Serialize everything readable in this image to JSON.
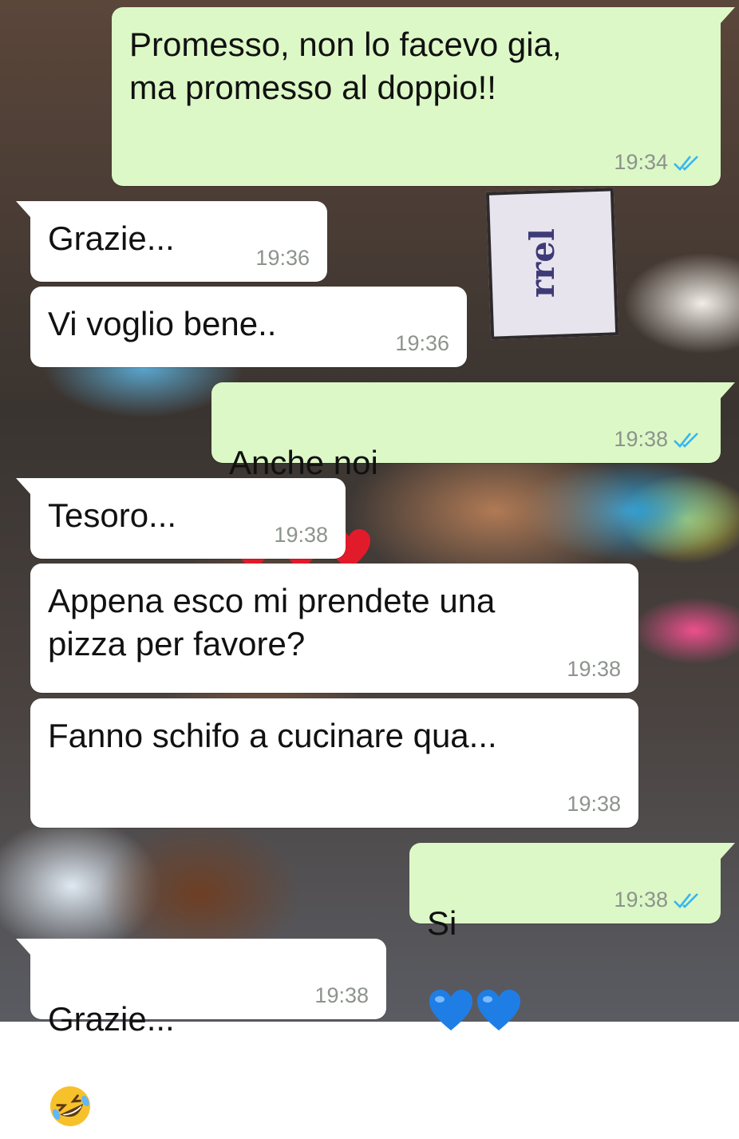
{
  "messages": [
    {
      "dir": "out",
      "text": "Promesso, non lo facevo gia,\nma promesso al doppio!!",
      "time": "19:34",
      "status": "read"
    },
    {
      "dir": "in",
      "text": "Grazie...",
      "time": "19:36"
    },
    {
      "dir": "in",
      "text": "Vi voglio bene..",
      "time": "19:36"
    },
    {
      "dir": "out",
      "text": "Anche noi",
      "emojis": [
        "red-heart",
        "red-heart",
        "red-heart"
      ],
      "time": "19:38",
      "status": "read"
    },
    {
      "dir": "in",
      "text": "Tesoro...",
      "time": "19:38"
    },
    {
      "dir": "in",
      "text": "Appena esco mi prendete una\npizza per favore?",
      "time": "19:38"
    },
    {
      "dir": "in",
      "text": "Fanno schifo a cucinare qua...",
      "time": "19:38"
    },
    {
      "dir": "out",
      "text": "Si",
      "emojis": [
        "blue-heart",
        "blue-heart"
      ],
      "time": "19:38",
      "status": "read"
    },
    {
      "dir": "in",
      "text": "Grazie...",
      "emojis": [
        "rolling-on-floor-laughing"
      ],
      "time": "19:38"
    }
  ],
  "wallpaper": {
    "tag_text": "rrel"
  },
  "colors": {
    "outgoing_bubble": "#dcf8c6",
    "incoming_bubble": "#ffffff",
    "read_ticks": "#34b7f1",
    "timestamp": "#8d938d"
  }
}
